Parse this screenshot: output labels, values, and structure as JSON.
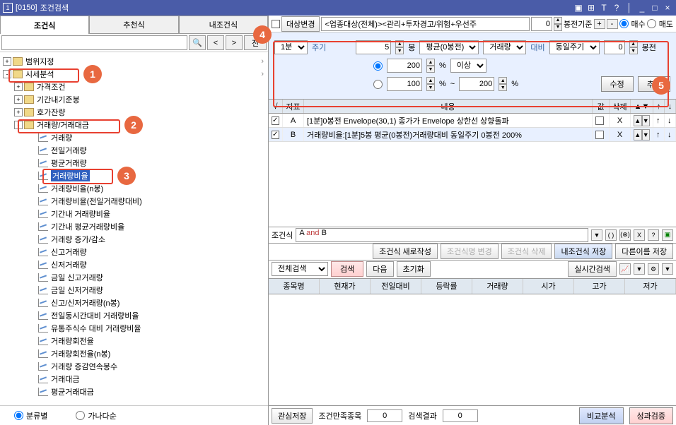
{
  "title": {
    "id": "[0150]",
    "text": "조건검색"
  },
  "titlebar_buttons": [
    "▣",
    "⊞",
    "T",
    "?",
    "│",
    "_",
    "□",
    "×"
  ],
  "tabs": {
    "main": "조건식",
    "recommend": "추천식",
    "my": "내조건식"
  },
  "search": {
    "placeholder": "",
    "btn_search": "🔍",
    "btn_prev": "<",
    "btn_next": ">",
    "btn_full": "전"
  },
  "tree": {
    "item0": "범위지정",
    "item1": "시세분석",
    "item1_1": "가격조건",
    "item1_2": "기간내기준봉",
    "item1_3": "호가잔량",
    "item1_4": "거래량/거래대금",
    "item1_4_0": "거래량",
    "item1_4_1": "전일거래량",
    "item1_4_2": "평균거래량",
    "item1_4_3": "거래량비율",
    "item1_4_4": "거래량비율(n봉)",
    "item1_4_5": "거래량비율(전일거래량대비)",
    "item1_4_6": "기간내 거래량비율",
    "item1_4_7": "기간내 평균거래량비율",
    "item1_4_8": "거래량 증가/감소",
    "item1_4_9": "신고거래량",
    "item1_4_10": "신저거래량",
    "item1_4_11": "금일 신고거래량",
    "item1_4_12": "금일 신저거래량",
    "item1_4_13": "신고/신저거래량(n봉)",
    "item1_4_14": "전일동시간대비 거래량비율",
    "item1_4_15": "유통주식수 대비 거래량비율",
    "item1_4_16": "거래량회전율",
    "item1_4_17": "거래량회전율(n봉)",
    "item1_4_18": "거래량 증감연속봉수",
    "item1_4_19": "거래대금",
    "item1_4_20": "평균거래대금"
  },
  "sort": {
    "by_category": "분류별",
    "by_name": "가나다순"
  },
  "target": {
    "label": "대상변경",
    "scope": "<업종대상(전체)><관리+투자경고/위험+우선주",
    "zero": "0",
    "bong_std": "봉전기준",
    "plus": "+",
    "minus": "-",
    "buy": "매수",
    "sell": "매도"
  },
  "params": {
    "period_val": "1분",
    "period_label": "주기",
    "bong_val": "5",
    "bong_label": "봉",
    "avg": "평균(0봉전)",
    "vol": "거래량",
    "ratio_label": "대비",
    "same_period": "동일주기",
    "zero": "0",
    "bong_before": "봉전",
    "val1": "200",
    "pct": "%",
    "above": "이상",
    "val2": "100",
    "tilde": "~",
    "val3": "200",
    "modify": "수정",
    "add": "추가"
  },
  "cond_header": {
    "chk": "√",
    "indicator": "지표",
    "content": "내용",
    "val": "값",
    "del": "삭제",
    "up": "↑",
    "down": "↓"
  },
  "conditions": [
    {
      "id": "A",
      "text": "[1분]0봉전 Envelope(30,1) 종가가 Envelope 상한선 상향돌파",
      "checked": true
    },
    {
      "id": "B",
      "text": "거래량비율:[1분]5봉 평균(0봉전)거래량대비 동일주기 0봉전 200%",
      "checked": true
    }
  ],
  "formula": {
    "label": "조건식",
    "a": "A",
    "and": "and",
    "b": "B"
  },
  "actions": {
    "new": "조건식 새로작성",
    "rename": "조건식명 변경",
    "delete": "조건식 삭제",
    "save_my": "내조건식 저장",
    "save_as": "다른이름 저장"
  },
  "search_actions": {
    "scope": "전체검색",
    "search": "검색",
    "next": "다음",
    "reset": "초기화",
    "realtime": "실시간검색"
  },
  "results_cols": [
    "종목명",
    "현재가",
    "전일대비",
    "등락률",
    "거래량",
    "시가",
    "고가",
    "저가"
  ],
  "bottom": {
    "save_interest": "관심저장",
    "cond_match": "조건만족종목",
    "zero1": "0",
    "search_result": "검색결과",
    "zero2": "0",
    "compare": "비교분석",
    "verify": "성과검증"
  }
}
